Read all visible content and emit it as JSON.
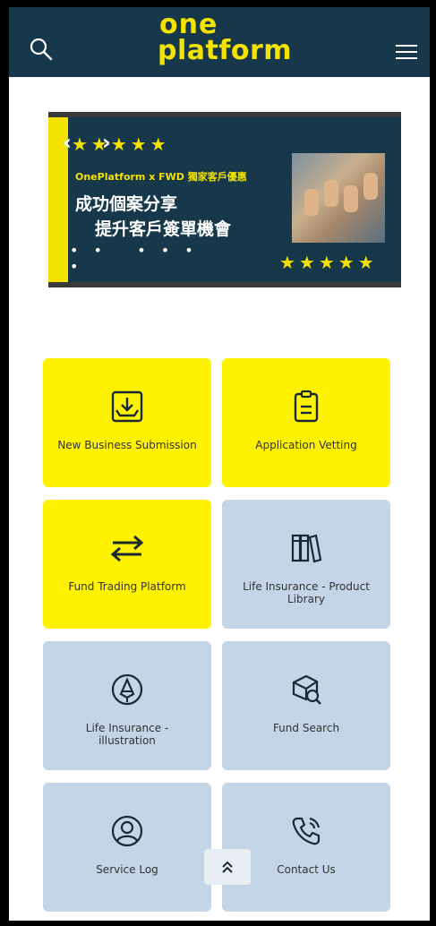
{
  "header": {
    "logo_line1": "one",
    "logo_line2": "platform"
  },
  "banner": {
    "subtitle": "OnePlatform x FWD 獨家客戶優惠",
    "title_line1": "成功個案分享",
    "title_line2": "提升客戶簽單機會"
  },
  "tiles": [
    {
      "label": "New Business Submission",
      "icon": "download-tray-icon"
    },
    {
      "label": "Application Vetting",
      "icon": "clipboard-icon"
    },
    {
      "label": "Fund Trading Platform",
      "icon": "swap-arrows-icon"
    },
    {
      "label": "Life Insurance - Product Library",
      "icon": "books-icon"
    },
    {
      "label": "Life Insurance - illustration",
      "icon": "pen-nib-icon"
    },
    {
      "label": "Fund Search",
      "icon": "box-search-icon"
    },
    {
      "label": "Service Log",
      "icon": "user-circle-icon"
    },
    {
      "label": "Contact Us",
      "icon": "phone-icon"
    }
  ],
  "colors": {
    "header_bg": "#16384a",
    "brand_yellow": "#fff200",
    "tile_blue": "#c3d5e6"
  }
}
